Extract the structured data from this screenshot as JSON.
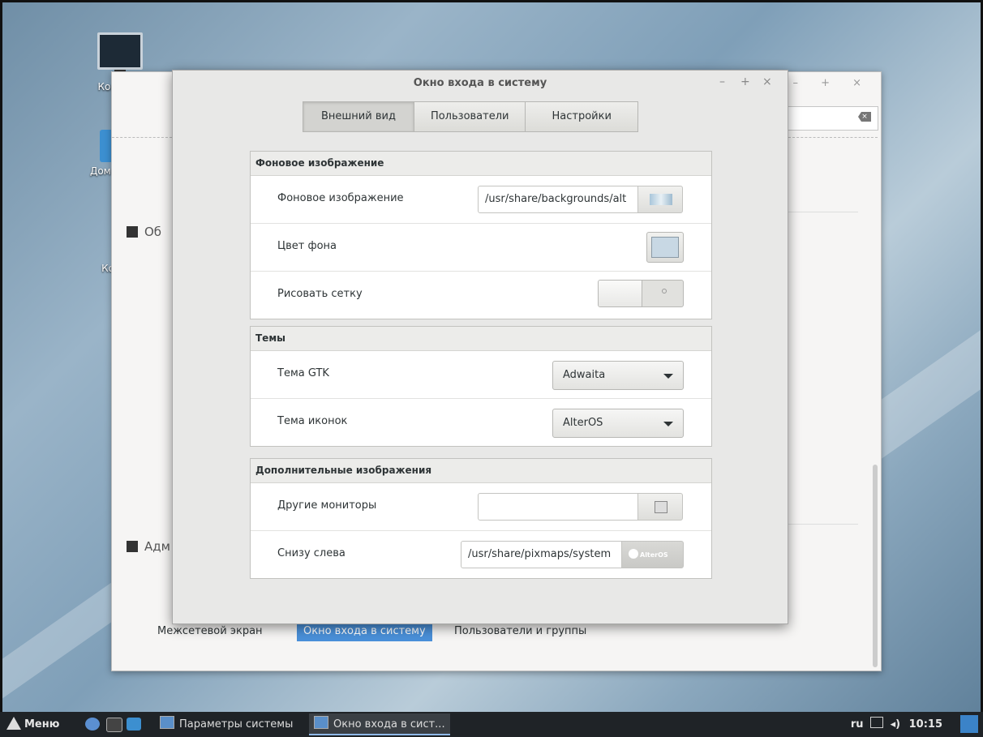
{
  "desktop": {
    "icons": [
      {
        "name": "computer",
        "label": "Ком"
      },
      {
        "name": "home",
        "label": "Домаш"
      },
      {
        "name": "trash",
        "label": "Ко"
      }
    ]
  },
  "background_window": {
    "sections": [
      "Об",
      "Адм"
    ],
    "bottom_tabs": [
      "Межсетевой экран",
      "Окно входа в систему",
      "Пользователи и группы"
    ],
    "active_tab": "Окно входа в систему"
  },
  "dialog": {
    "title": "Окно входа в систему",
    "tabs": [
      "Внешний вид",
      "Пользователи",
      "Настройки"
    ],
    "active_tab": "Внешний вид",
    "groups": {
      "background": {
        "heading": "Фоновое изображение",
        "image_label": "Фоновое изображение",
        "image_path": "/usr/share/backgrounds/alt",
        "color_label": "Цвет фона",
        "color_value": "#c8d8e4",
        "grid_label": "Рисовать сетку",
        "grid_enabled": false
      },
      "themes": {
        "heading": "Темы",
        "gtk_label": "Тема GTK",
        "gtk_value": "Adwaita",
        "icons_label": "Тема иконок",
        "icons_value": "AlterOS"
      },
      "extra": {
        "heading": "Дополнительные изображения",
        "monitors_label": "Другие мониторы",
        "monitors_value": "",
        "bottom_left_label": "Снизу слева",
        "bottom_left_path": "/usr/share/pixmaps/system",
        "bottom_left_logo": "AlterOS"
      }
    }
  },
  "panel": {
    "menu_label": "Меню",
    "tasks": [
      "Параметры системы",
      "Окно входа в сист..."
    ],
    "active_task": "Окно входа в сист...",
    "layout": "ru",
    "clock": "10:15"
  },
  "colors": {
    "accent": "#4a90d9",
    "panel_bg": "#1f2327"
  }
}
